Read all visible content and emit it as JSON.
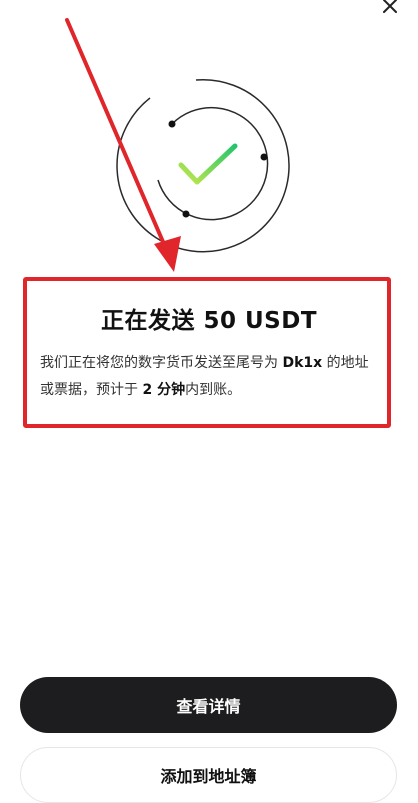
{
  "icons": {
    "close": "close-icon",
    "success": "checkmark-icon",
    "annotation": "red-arrow"
  },
  "colors": {
    "accent_green_start": "#c5e84a",
    "accent_green_end": "#22c56b",
    "annotation_red": "#e0262b",
    "primary_button_bg": "#1d1d1f"
  },
  "status": {
    "title": "正在发送 50 USDT",
    "description_part1": "我们正在将您的数字货币发送至尾号为 ",
    "address_suffix": "Dk1x",
    "description_part2": " 的地址或票据，预计于 ",
    "eta": "2 分钟",
    "description_part3": "内到账。"
  },
  "actions": {
    "view_details_label": "查看详情",
    "add_to_address_book_label": "添加到地址簿"
  }
}
